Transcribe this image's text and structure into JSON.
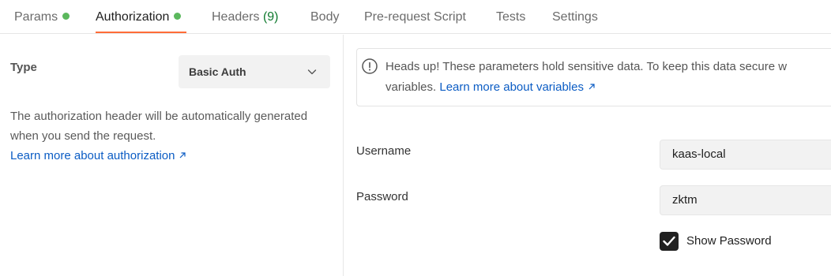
{
  "tabs": [
    {
      "label": "Params",
      "dot": true
    },
    {
      "label": "Authorization",
      "dot": true,
      "active": true
    },
    {
      "label": "Headers",
      "count": "(9)"
    },
    {
      "label": "Body"
    },
    {
      "label": "Pre-request Script"
    },
    {
      "label": "Tests"
    },
    {
      "label": "Settings"
    }
  ],
  "colors": {
    "active_underline": "#ff6c37",
    "status_dot": "#5bb85d",
    "link": "#0b5cc4"
  },
  "auth": {
    "type_label": "Type",
    "type_value": "Basic Auth",
    "description": "The authorization header will be automatically generated when you send the request.",
    "learn_more": "Learn more about authorization"
  },
  "callout": {
    "text_line1": "Heads up! These parameters hold sensitive data. To keep this data secure w",
    "text_line2_prefix": "variables.",
    "link": "Learn more about variables"
  },
  "form": {
    "username_label": "Username",
    "username_value": "kaas-local",
    "password_label": "Password",
    "password_value": "zktm",
    "show_password_label": "Show Password",
    "show_password_checked": true
  },
  "icons": {
    "chevron": "chevron-down-icon",
    "external": "external-link-icon",
    "info": "info-icon",
    "check": "check-icon"
  }
}
